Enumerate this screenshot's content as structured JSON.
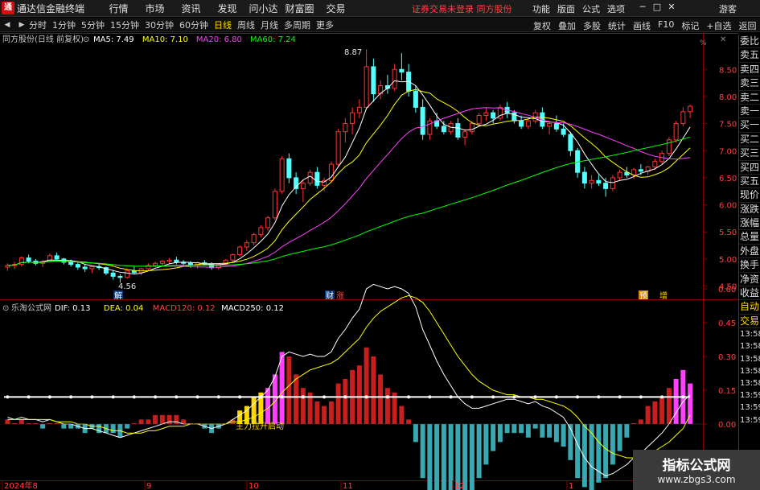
{
  "titlebar": {
    "logo": "通",
    "app_name": "通达信金融终端",
    "menu": [
      "行情",
      "市场",
      "资讯",
      "发现",
      "问小达",
      "财富圈",
      "交易"
    ],
    "notice": "证券交易未登录  同方股份",
    "right_menu": [
      "功能",
      "版面",
      "公式",
      "选项"
    ],
    "guest": "游客"
  },
  "periodbar": {
    "periods": [
      "分时",
      "1分钟",
      "5分钟",
      "15分钟",
      "30分钟",
      "60分钟",
      "日线",
      "周线",
      "月线",
      "多周期",
      "更多"
    ],
    "active": "日线",
    "tools": [
      "复权",
      "叠加",
      "多股",
      "统计",
      "画线",
      "F10",
      "标记",
      "+自选",
      "返回"
    ]
  },
  "main_chart": {
    "title": "同方股份(日线 前复权)",
    "ma": [
      {
        "label": "MA5: 7.49",
        "color": "#ffffff"
      },
      {
        "label": "MA10: 7.10",
        "color": "#ffff00"
      },
      {
        "label": "MA20: 6.80",
        "color": "#ff40ff"
      },
      {
        "label": "MA60: 7.24",
        "color": "#00ff00"
      }
    ],
    "y_ticks": [
      "8.50",
      "8.00",
      "7.50",
      "7.00",
      "6.50",
      "6.00",
      "5.50",
      "5.00",
      "4.50"
    ],
    "y_top_label": "%",
    "high_label": "8.87",
    "low_label": "4.56",
    "events": [
      "解",
      "财",
      "预",
      "增"
    ]
  },
  "macd_panel": {
    "formula": "乐淘公式网",
    "values": [
      {
        "label": "DIF: 0.13",
        "color": "#ffffff"
      },
      {
        "label": "DEA: 0.04",
        "color": "#ffff00"
      },
      {
        "label": "MACD120: 0.12",
        "color": "#ff4040"
      },
      {
        "label": "MACD250: 0.12",
        "color": "#ffffff"
      }
    ],
    "y_ticks": [
      "0.60",
      "0.45",
      "0.30",
      "0.15",
      "0.00",
      "-0.15"
    ],
    "annotation": "主力拉升启动"
  },
  "x_axis": [
    "2024年8",
    "9",
    "10",
    "11",
    "12",
    "1"
  ],
  "side_panel": {
    "tabs": [
      "委比",
      "卖五",
      "卖四",
      "卖三",
      "卖二",
      "卖一",
      "买一",
      "买二",
      "买三",
      "买四",
      "买五",
      "现价",
      "涨跌",
      "涨幅",
      "总量",
      "外盘",
      "换手",
      "净资",
      "收益",
      "自动",
      "交易"
    ],
    "times": [
      "13:58",
      "13:58",
      "13:58",
      "13:58",
      "13:58",
      "13:59",
      "13:59",
      "13:59"
    ]
  },
  "watermark": {
    "title": "指标公式网",
    "url": "www.zbgs3.com"
  },
  "chart_data": {
    "type": "candlestick",
    "title": "同方股份(日线 前复权)",
    "x_labels": [
      "2024年8",
      "9",
      "10",
      "11",
      "12",
      "1"
    ],
    "ylim": [
      4.3,
      8.95
    ],
    "ohlc": [
      [
        4.85,
        4.92,
        4.78,
        4.88
      ],
      [
        4.88,
        4.95,
        4.82,
        4.9
      ],
      [
        4.9,
        5.05,
        4.86,
        5.02
      ],
      [
        5.02,
        5.08,
        4.92,
        4.96
      ],
      [
        4.96,
        5.0,
        4.88,
        4.92
      ],
      [
        4.92,
        4.98,
        4.85,
        4.95
      ],
      [
        4.95,
        5.1,
        4.93,
        5.06
      ],
      [
        5.06,
        5.12,
        4.98,
        5.0
      ],
      [
        5.0,
        5.02,
        4.9,
        4.94
      ],
      [
        4.94,
        4.99,
        4.86,
        4.9
      ],
      [
        4.9,
        4.94,
        4.8,
        4.85
      ],
      [
        4.85,
        4.9,
        4.76,
        4.82
      ],
      [
        4.82,
        4.88,
        4.74,
        4.86
      ],
      [
        4.86,
        4.92,
        4.8,
        4.84
      ],
      [
        4.84,
        4.86,
        4.7,
        4.74
      ],
      [
        4.74,
        4.8,
        4.62,
        4.68
      ],
      [
        4.68,
        4.72,
        4.56,
        4.66
      ],
      [
        4.66,
        4.82,
        4.64,
        4.78
      ],
      [
        4.78,
        4.86,
        4.72,
        4.75
      ],
      [
        4.75,
        4.84,
        4.7,
        4.82
      ],
      [
        4.82,
        4.92,
        4.78,
        4.88
      ],
      [
        4.88,
        4.95,
        4.84,
        4.92
      ],
      [
        4.92,
        4.98,
        4.88,
        4.96
      ],
      [
        4.96,
        5.02,
        4.9,
        4.98
      ],
      [
        4.98,
        5.04,
        4.9,
        4.94
      ],
      [
        4.94,
        4.98,
        4.86,
        4.92
      ],
      [
        4.92,
        4.96,
        4.84,
        4.88
      ],
      [
        4.88,
        4.95,
        4.82,
        4.93
      ],
      [
        4.93,
        4.98,
        4.88,
        4.9
      ],
      [
        4.9,
        4.94,
        4.8,
        4.84
      ],
      [
        4.84,
        4.92,
        4.8,
        4.9
      ],
      [
        4.9,
        5.0,
        4.88,
        4.98
      ],
      [
        4.98,
        5.1,
        4.95,
        5.08
      ],
      [
        5.08,
        5.25,
        5.05,
        5.22
      ],
      [
        5.22,
        5.35,
        5.15,
        5.3
      ],
      [
        5.3,
        5.48,
        5.25,
        5.45
      ],
      [
        5.45,
        5.62,
        5.4,
        5.58
      ],
      [
        5.58,
        5.8,
        5.52,
        5.76
      ],
      [
        5.76,
        6.3,
        5.72,
        6.25
      ],
      [
        6.25,
        6.9,
        6.2,
        6.85
      ],
      [
        6.85,
        6.95,
        6.4,
        6.5
      ],
      [
        6.5,
        6.6,
        6.2,
        6.3
      ],
      [
        6.3,
        6.45,
        6.05,
        6.4
      ],
      [
        6.4,
        6.65,
        6.35,
        6.6
      ],
      [
        6.6,
        6.7,
        6.3,
        6.36
      ],
      [
        6.36,
        6.5,
        6.25,
        6.45
      ],
      [
        6.45,
        6.8,
        6.4,
        6.75
      ],
      [
        6.75,
        7.4,
        6.7,
        7.35
      ],
      [
        7.35,
        7.6,
        7.15,
        7.5
      ],
      [
        7.5,
        7.8,
        7.3,
        7.7
      ],
      [
        7.7,
        7.95,
        7.6,
        7.8
      ],
      [
        7.8,
        8.87,
        7.75,
        8.55
      ],
      [
        8.55,
        8.7,
        7.9,
        8.05
      ],
      [
        8.05,
        8.3,
        7.95,
        8.2
      ],
      [
        8.2,
        8.4,
        8.05,
        8.15
      ],
      [
        8.15,
        8.6,
        8.1,
        8.5
      ],
      [
        8.5,
        8.8,
        8.3,
        8.45
      ],
      [
        8.45,
        8.6,
        8.0,
        8.1
      ],
      [
        8.1,
        8.2,
        7.7,
        7.8
      ],
      [
        7.8,
        7.95,
        7.2,
        7.3
      ],
      [
        7.3,
        7.6,
        7.2,
        7.55
      ],
      [
        7.55,
        7.7,
        7.4,
        7.45
      ],
      [
        7.45,
        7.55,
        7.3,
        7.35
      ],
      [
        7.35,
        7.55,
        7.3,
        7.5
      ],
      [
        7.5,
        7.6,
        7.2,
        7.25
      ],
      [
        7.25,
        7.4,
        7.1,
        7.35
      ],
      [
        7.35,
        7.55,
        7.3,
        7.5
      ],
      [
        7.5,
        7.7,
        7.45,
        7.65
      ],
      [
        7.65,
        7.8,
        7.55,
        7.7
      ],
      [
        7.7,
        7.75,
        7.5,
        7.6
      ],
      [
        7.6,
        7.85,
        7.55,
        7.8
      ],
      [
        7.8,
        7.9,
        7.6,
        7.7
      ],
      [
        7.7,
        7.75,
        7.5,
        7.55
      ],
      [
        7.55,
        7.65,
        7.4,
        7.45
      ],
      [
        7.45,
        7.6,
        7.4,
        7.55
      ],
      [
        7.55,
        7.75,
        7.5,
        7.7
      ],
      [
        7.7,
        7.8,
        7.4,
        7.45
      ],
      [
        7.45,
        7.55,
        7.3,
        7.5
      ],
      [
        7.5,
        7.65,
        7.35,
        7.4
      ],
      [
        7.4,
        7.5,
        7.25,
        7.3
      ],
      [
        7.3,
        7.35,
        6.9,
        7.0
      ],
      [
        7.0,
        7.05,
        6.5,
        6.6
      ],
      [
        6.6,
        6.7,
        6.3,
        6.4
      ],
      [
        6.4,
        6.55,
        6.3,
        6.45
      ],
      [
        6.45,
        6.55,
        6.35,
        6.4
      ],
      [
        6.4,
        6.5,
        6.15,
        6.3
      ],
      [
        6.3,
        6.55,
        6.25,
        6.5
      ],
      [
        6.5,
        6.65,
        6.45,
        6.6
      ],
      [
        6.6,
        6.7,
        6.5,
        6.55
      ],
      [
        6.55,
        6.68,
        6.48,
        6.65
      ],
      [
        6.65,
        6.75,
        6.55,
        6.62
      ],
      [
        6.62,
        6.72,
        6.55,
        6.7
      ],
      [
        6.7,
        6.85,
        6.65,
        6.8
      ],
      [
        6.8,
        7.0,
        6.75,
        6.95
      ],
      [
        6.95,
        7.25,
        6.9,
        7.2
      ],
      [
        7.2,
        7.55,
        7.15,
        7.5
      ],
      [
        7.5,
        7.8,
        7.45,
        7.72
      ],
      [
        7.72,
        7.85,
        7.6,
        7.82
      ]
    ],
    "ma_labels": [
      "MA5: 7.49",
      "MA10: 7.10",
      "MA20: 6.80",
      "MA60: 7.24"
    ],
    "macd": {
      "dif": [
        0.03,
        0.02,
        0.03,
        0.02,
        0.02,
        0.01,
        0.02,
        0.01,
        0.0,
        0.0,
        -0.01,
        -0.02,
        -0.02,
        -0.03,
        -0.04,
        -0.05,
        -0.06,
        -0.05,
        -0.04,
        -0.03,
        -0.02,
        -0.01,
        0.0,
        0.01,
        0.01,
        0.0,
        0.0,
        0.0,
        -0.01,
        -0.02,
        -0.01,
        0.0,
        0.02,
        0.04,
        0.06,
        0.09,
        0.12,
        0.15,
        0.21,
        0.3,
        0.32,
        0.31,
        0.3,
        0.31,
        0.3,
        0.3,
        0.32,
        0.38,
        0.42,
        0.47,
        0.51,
        0.6,
        0.62,
        0.61,
        0.6,
        0.61,
        0.6,
        0.58,
        0.52,
        0.42,
        0.35,
        0.28,
        0.22,
        0.17,
        0.12,
        0.09,
        0.07,
        0.07,
        0.08,
        0.09,
        0.1,
        0.11,
        0.11,
        0.1,
        0.09,
        0.1,
        0.08,
        0.07,
        0.05,
        0.03,
        -0.02,
        -0.09,
        -0.15,
        -0.19,
        -0.21,
        -0.23,
        -0.22,
        -0.2,
        -0.18,
        -0.15,
        -0.13,
        -0.1,
        -0.07,
        -0.04,
        0.0,
        0.05,
        0.1,
        0.13
      ],
      "dea": [
        0.02,
        0.02,
        0.02,
        0.02,
        0.02,
        0.02,
        0.02,
        0.01,
        0.01,
        0.01,
        0.0,
        0.0,
        -0.01,
        -0.01,
        -0.02,
        -0.03,
        -0.03,
        -0.04,
        -0.04,
        -0.04,
        -0.03,
        -0.03,
        -0.02,
        -0.01,
        -0.01,
        -0.01,
        0.0,
        0.0,
        0.0,
        0.0,
        0.0,
        0.0,
        0.01,
        0.01,
        0.02,
        0.03,
        0.05,
        0.07,
        0.1,
        0.14,
        0.17,
        0.2,
        0.22,
        0.24,
        0.25,
        0.26,
        0.27,
        0.29,
        0.32,
        0.35,
        0.38,
        0.43,
        0.47,
        0.5,
        0.52,
        0.54,
        0.56,
        0.57,
        0.56,
        0.54,
        0.5,
        0.45,
        0.4,
        0.35,
        0.3,
        0.26,
        0.22,
        0.19,
        0.17,
        0.15,
        0.14,
        0.13,
        0.13,
        0.12,
        0.12,
        0.11,
        0.11,
        0.1,
        0.09,
        0.08,
        0.06,
        0.03,
        -0.01,
        -0.04,
        -0.08,
        -0.11,
        -0.13,
        -0.14,
        -0.15,
        -0.15,
        -0.14,
        -0.14,
        -0.12,
        -0.1,
        -0.08,
        -0.05,
        -0.02,
        0.04
      ]
    }
  }
}
